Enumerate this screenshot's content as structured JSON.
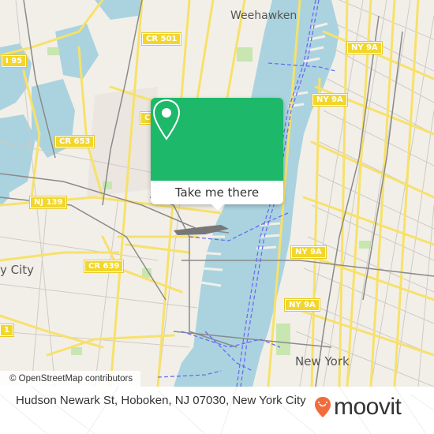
{
  "map": {
    "attribution": "© OpenStreetMap contributors",
    "colors": {
      "land": "#f2efe9",
      "water": "#aad3df",
      "road_major": "#f7e16a",
      "rail": "#8a8a8a",
      "ferry": "#6b6bf0",
      "park": "#c8e6b0"
    },
    "road_shields": [
      {
        "label": "I 95"
      },
      {
        "label": "CR 501"
      },
      {
        "label": "CR 653"
      },
      {
        "label": "NJ 139"
      },
      {
        "label": "CR 639"
      },
      {
        "label": "NY 9A"
      },
      {
        "label": "NY 9A"
      },
      {
        "label": "NY 9A"
      },
      {
        "label": "NY 9A"
      },
      {
        "label": "1"
      },
      {
        "label": "C"
      }
    ],
    "places": [
      {
        "label": "Weehawken"
      },
      {
        "label": "y City"
      },
      {
        "label": "New York"
      }
    ]
  },
  "popup": {
    "icon": "map-pin-icon",
    "action_label": "Take me there",
    "color": "#1eb86a"
  },
  "footer": {
    "address": "Hudson Newark St, Hoboken, NJ 07030, New York City",
    "brand": "moovit",
    "brand_color": "#f26b3a"
  }
}
